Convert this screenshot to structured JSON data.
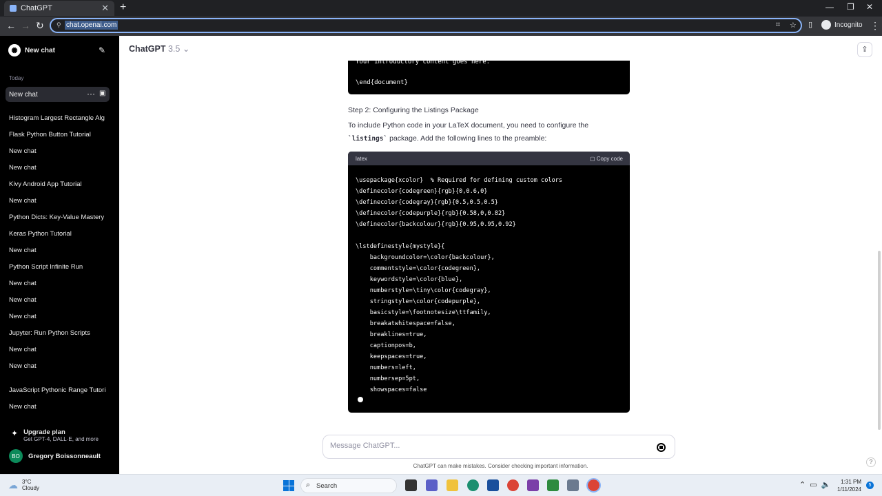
{
  "browser": {
    "tab_title": "ChatGPT",
    "new_tab": "+",
    "url": "chat.openai.com",
    "profile": "Incognito"
  },
  "sidebar": {
    "new_chat": "New chat",
    "section_today": "Today",
    "active_chat": "New chat",
    "items": [
      "Histogram Largest Rectangle Alg",
      "Flask Python Button Tutorial",
      "New chat",
      "New chat",
      "Kivy Android App Tutorial",
      "New chat",
      "Python Dicts: Key-Value Mastery",
      "Keras Python Tutorial",
      "New chat",
      "Python Script Infinite Run",
      "New chat",
      "New chat",
      "New chat",
      "Jupyter: Run Python Scripts",
      "New chat",
      "New chat",
      "JavaScript Pythonic Range Tutori",
      "New chat"
    ],
    "upgrade_title": "Upgrade plan",
    "upgrade_sub": "Get GPT-4, DALL·E, and more",
    "user_initials": "BO",
    "user_name": "Gregory Boissonneault"
  },
  "main": {
    "model": "ChatGPT",
    "model_version": "3.5",
    "code_top_cut": "Your introductory content goes here.",
    "code_top_end": "\\end{document}",
    "step": "Step 2: Configuring the Listings Package",
    "para_1": "To include Python code in your LaTeX document, you need to configure the",
    "para_code": "`listings`",
    "para_2": " package. Add the following lines to the preamble:",
    "code_lang": "latex",
    "copy_label": "Copy code",
    "code": "\\usepackage{xcolor}  % Required for defining custom colors\n\\definecolor{codegreen}{rgb}{0,0.6,0}\n\\definecolor{codegray}{rgb}{0.5,0.5,0.5}\n\\definecolor{codepurple}{rgb}{0.58,0,0.82}\n\\definecolor{backcolour}{rgb}{0.95,0.95,0.92}\n\n\\lstdefinestyle{mystyle}{\n    backgroundcolor=\\color{backcolour},\n    commentstyle=\\color{codegreen},\n    keywordstyle=\\color{blue},\n    numberstyle=\\tiny\\color{codegray},\n    stringstyle=\\color{codepurple},\n    basicstyle=\\footnotesize\\ttfamily,\n    breakatwhitespace=false,\n    breaklines=true,\n    captionpos=b,\n    keepspaces=true,\n    numbers=left,\n    numbersep=5pt,\n    showspaces=false",
    "message_placeholder": "Message ChatGPT...",
    "disclaimer": "ChatGPT can make mistakes. Consider checking important information.",
    "help": "?"
  },
  "taskbar": {
    "temp": "3°C",
    "weather": "Cloudy",
    "search": "Search",
    "time": "1:31 PM",
    "date": "1/11/2024",
    "notifications": "5"
  },
  "colors": {
    "sidebar_bg": "#000000",
    "accent": "#8ab4f8",
    "user_avatar": "#0c8a5a"
  }
}
